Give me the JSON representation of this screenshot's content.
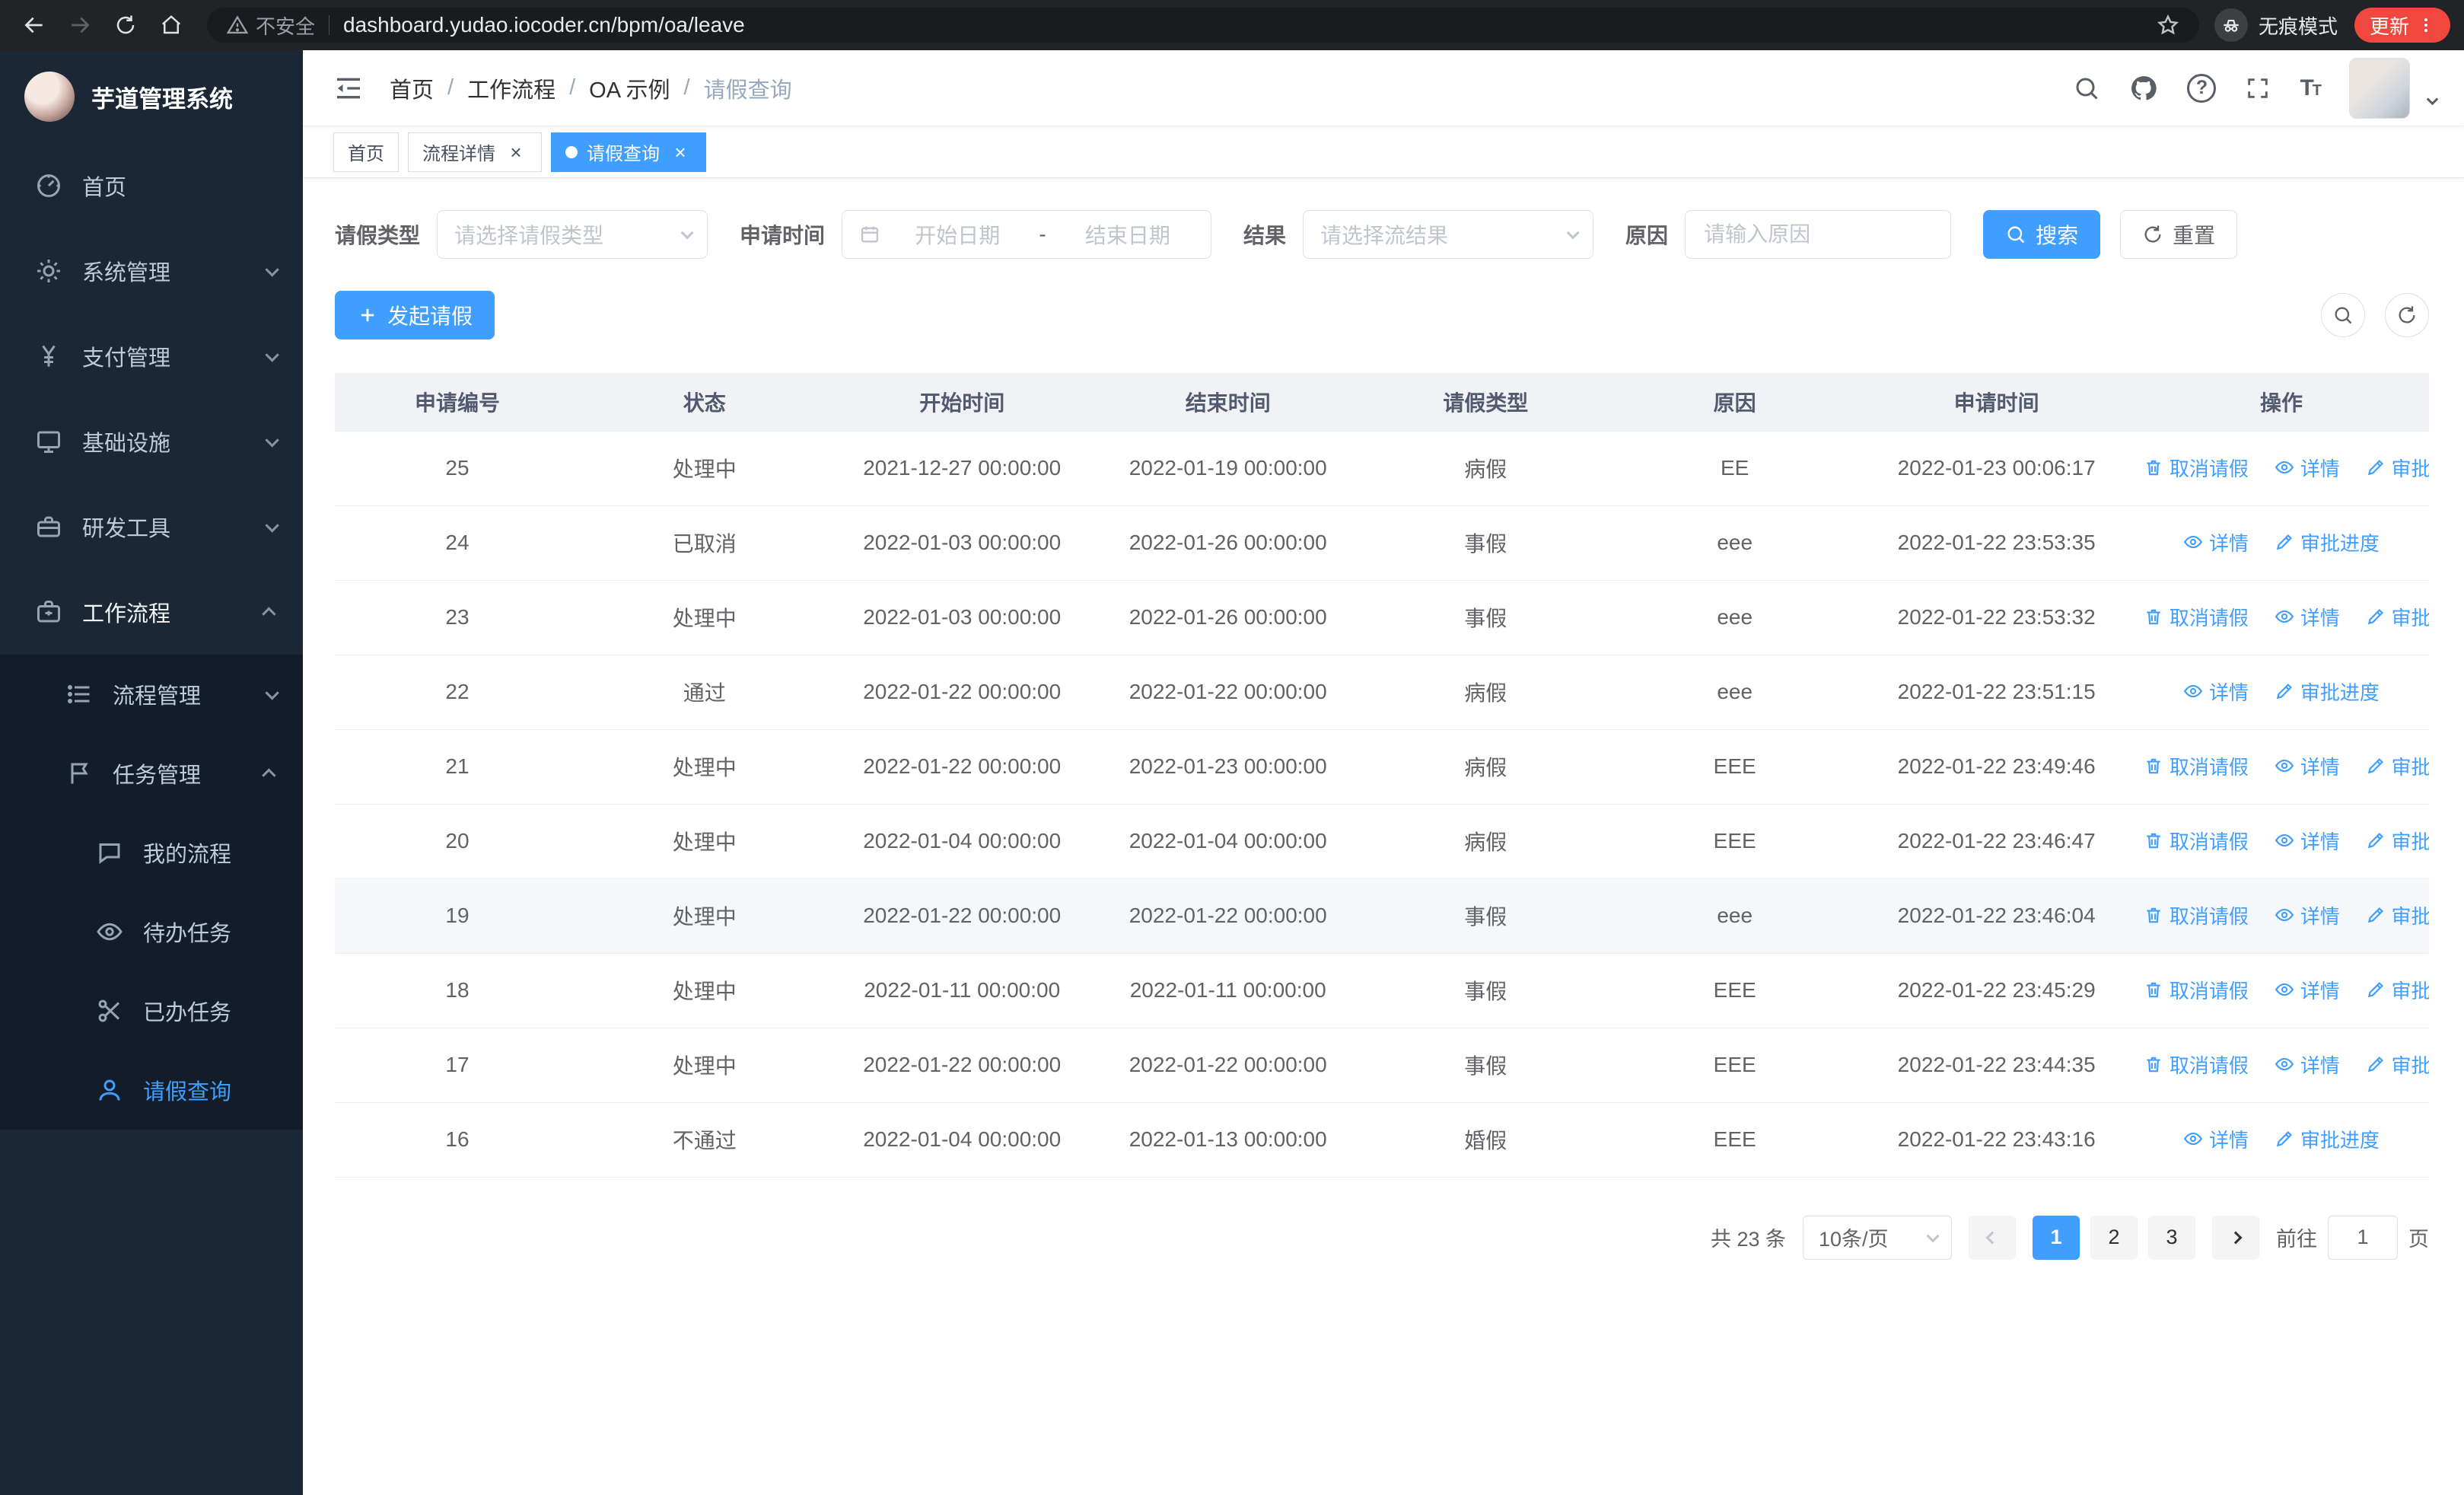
{
  "colors": {
    "accent": "#409eff",
    "update_red": "#f0483e",
    "sidebar_bg": "#1b2735",
    "submenu_bg": "#131d29"
  },
  "browser": {
    "security_warning": "不安全",
    "url": "dashboard.yudao.iocoder.cn/bpm/oa/leave",
    "incognito_label": "无痕模式",
    "update_label": "更新"
  },
  "sidebar": {
    "title": "芋道管理系统",
    "items": [
      {
        "label": "首页"
      },
      {
        "label": "系统管理"
      },
      {
        "label": "支付管理"
      },
      {
        "label": "基础设施"
      },
      {
        "label": "研发工具"
      },
      {
        "label": "工作流程"
      }
    ],
    "process_mgmt": "流程管理",
    "task_mgmt": "任务管理",
    "task_items": [
      {
        "label": "我的流程"
      },
      {
        "label": "待办任务"
      },
      {
        "label": "已办任务"
      },
      {
        "label": "请假查询"
      }
    ]
  },
  "header": {
    "breadcrumb": [
      "首页",
      "工作流程",
      "OA 示例",
      "请假查询"
    ]
  },
  "tabs": [
    {
      "label": "首页",
      "active": false,
      "closable": false
    },
    {
      "label": "流程详情",
      "active": false,
      "closable": true
    },
    {
      "label": "请假查询",
      "active": true,
      "closable": true
    }
  ],
  "filters": {
    "leave_type_label": "请假类型",
    "leave_type_placeholder": "请选择请假类型",
    "apply_time_label": "申请时间",
    "start_date_placeholder": "开始日期",
    "date_separator": "-",
    "end_date_placeholder": "结束日期",
    "result_label": "结果",
    "result_placeholder": "请选择流结果",
    "reason_label": "原因",
    "reason_placeholder": "请输入原因",
    "search_button": "搜索",
    "reset_button": "重置"
  },
  "toolbar": {
    "create_label": "发起请假"
  },
  "table": {
    "columns": [
      "申请编号",
      "状态",
      "开始时间",
      "结束时间",
      "请假类型",
      "原因",
      "申请时间",
      "操作"
    ],
    "action_labels": {
      "cancel": "取消请假",
      "detail": "详情",
      "progress": "审批进度"
    },
    "rows": [
      {
        "id": "25",
        "status": "处理中",
        "start": "2021-12-27 00:00:00",
        "end": "2022-01-19 00:00:00",
        "type": "病假",
        "reason": "EE",
        "applied": "2022-01-23 00:06:17",
        "cancellable": true,
        "highlight": false
      },
      {
        "id": "24",
        "status": "已取消",
        "start": "2022-01-03 00:00:00",
        "end": "2022-01-26 00:00:00",
        "type": "事假",
        "reason": "eee",
        "applied": "2022-01-22 23:53:35",
        "cancellable": false,
        "highlight": false
      },
      {
        "id": "23",
        "status": "处理中",
        "start": "2022-01-03 00:00:00",
        "end": "2022-01-26 00:00:00",
        "type": "事假",
        "reason": "eee",
        "applied": "2022-01-22 23:53:32",
        "cancellable": true,
        "highlight": false
      },
      {
        "id": "22",
        "status": "通过",
        "start": "2022-01-22 00:00:00",
        "end": "2022-01-22 00:00:00",
        "type": "病假",
        "reason": "eee",
        "applied": "2022-01-22 23:51:15",
        "cancellable": false,
        "highlight": false
      },
      {
        "id": "21",
        "status": "处理中",
        "start": "2022-01-22 00:00:00",
        "end": "2022-01-23 00:00:00",
        "type": "病假",
        "reason": "EEE",
        "applied": "2022-01-22 23:49:46",
        "cancellable": true,
        "highlight": false
      },
      {
        "id": "20",
        "status": "处理中",
        "start": "2022-01-04 00:00:00",
        "end": "2022-01-04 00:00:00",
        "type": "病假",
        "reason": "EEE",
        "applied": "2022-01-22 23:46:47",
        "cancellable": true,
        "highlight": false
      },
      {
        "id": "19",
        "status": "处理中",
        "start": "2022-01-22 00:00:00",
        "end": "2022-01-22 00:00:00",
        "type": "事假",
        "reason": "eee",
        "applied": "2022-01-22 23:46:04",
        "cancellable": true,
        "highlight": true
      },
      {
        "id": "18",
        "status": "处理中",
        "start": "2022-01-11 00:00:00",
        "end": "2022-01-11 00:00:00",
        "type": "事假",
        "reason": "EEE",
        "applied": "2022-01-22 23:45:29",
        "cancellable": true,
        "highlight": false
      },
      {
        "id": "17",
        "status": "处理中",
        "start": "2022-01-22 00:00:00",
        "end": "2022-01-22 00:00:00",
        "type": "事假",
        "reason": "EEE",
        "applied": "2022-01-22 23:44:35",
        "cancellable": true,
        "highlight": false
      },
      {
        "id": "16",
        "status": "不通过",
        "start": "2022-01-04 00:00:00",
        "end": "2022-01-13 00:00:00",
        "type": "婚假",
        "reason": "EEE",
        "applied": "2022-01-22 23:43:16",
        "cancellable": false,
        "highlight": false
      }
    ]
  },
  "pagination": {
    "total": "共 23 条",
    "page_size": "10条/页",
    "pages": [
      "1",
      "2",
      "3"
    ],
    "active_page": "1",
    "goto_label": "前往",
    "goto_value": "1",
    "page_unit": "页"
  }
}
